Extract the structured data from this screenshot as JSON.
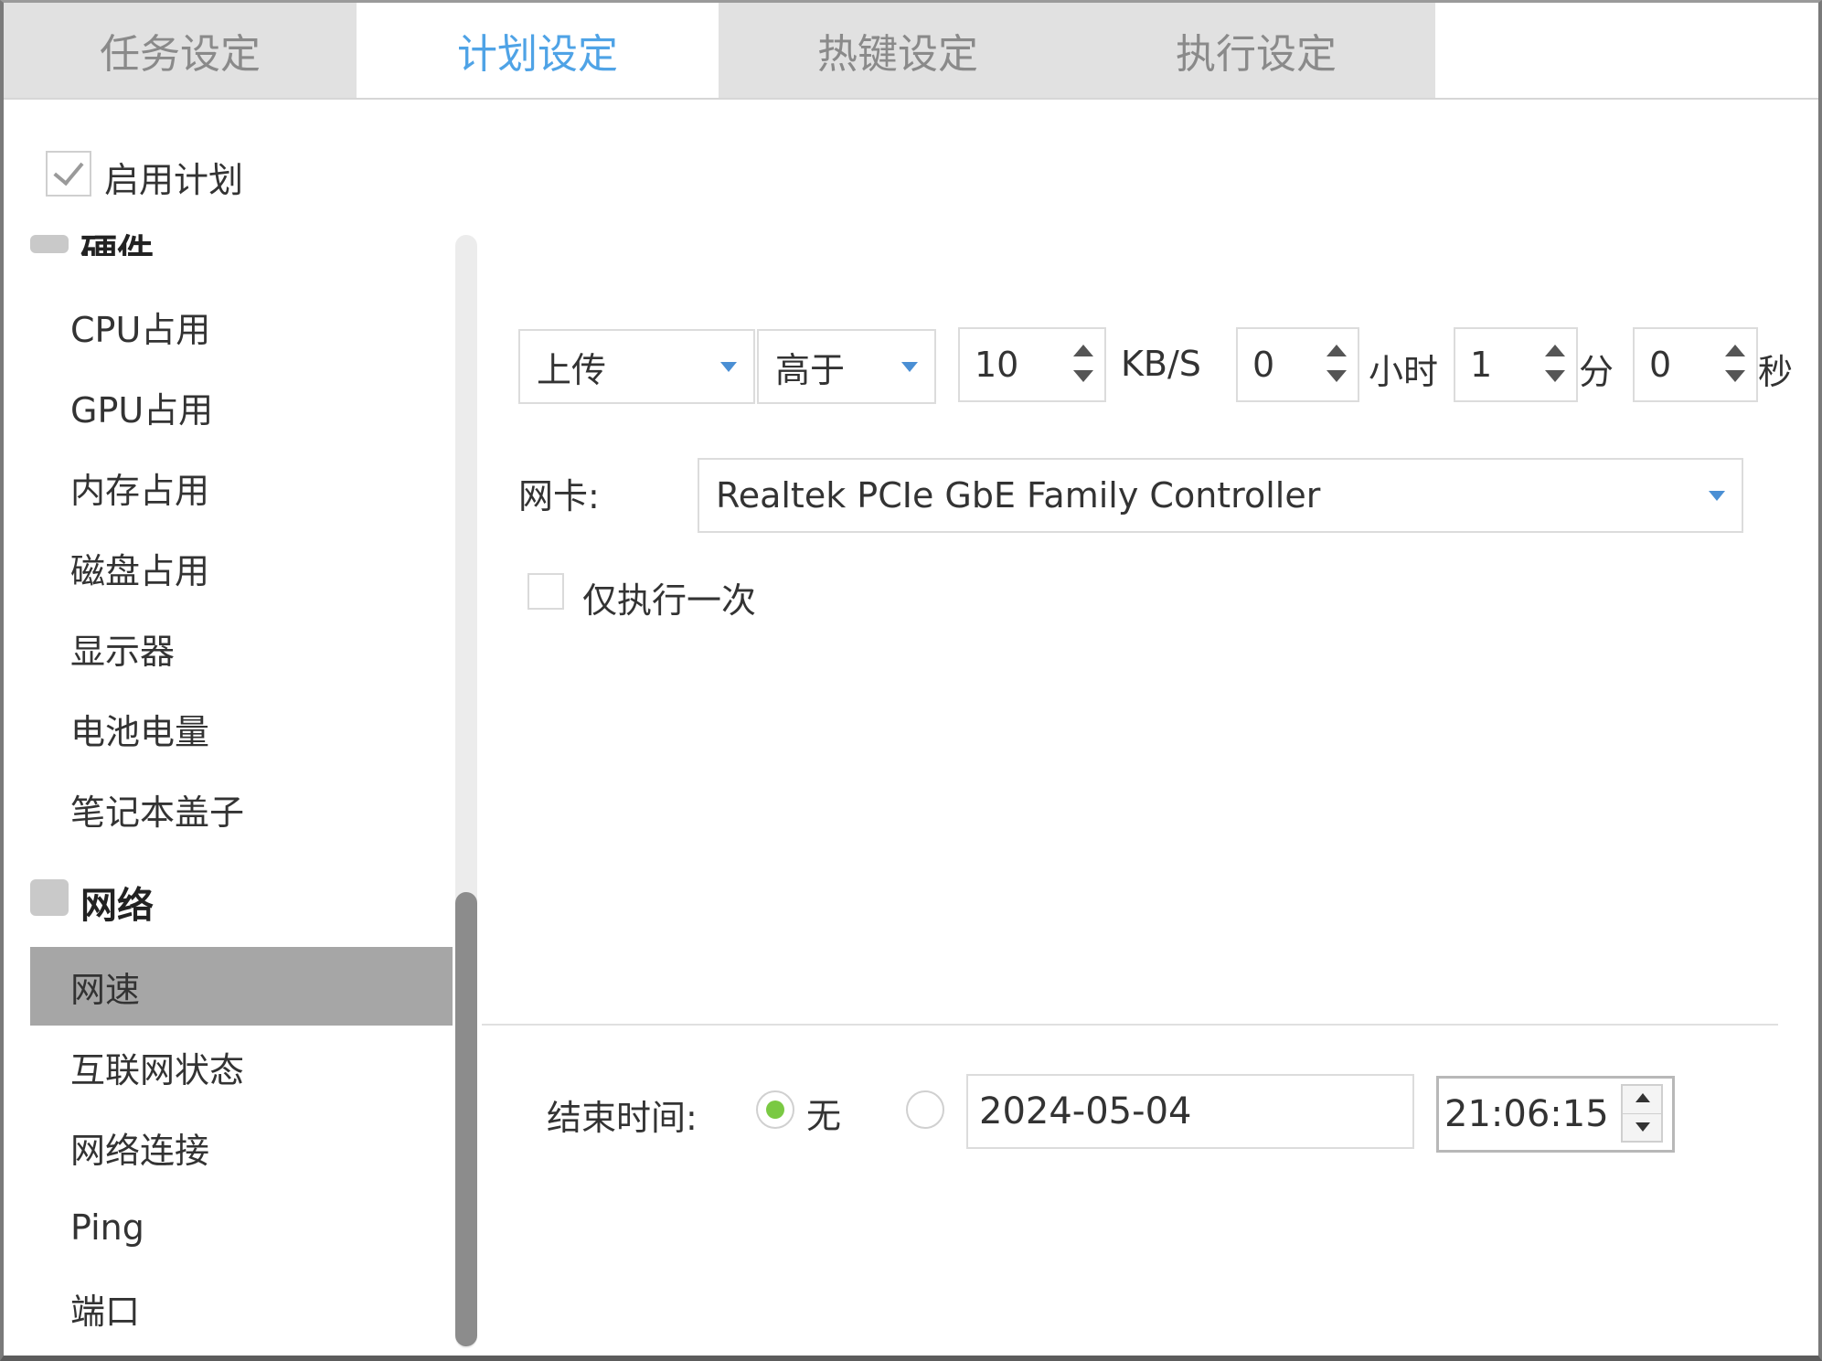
{
  "tabs": [
    {
      "label": "任务设定",
      "active": false
    },
    {
      "label": "计划设定",
      "active": true
    },
    {
      "label": "热键设定",
      "active": false
    },
    {
      "label": "执行设定",
      "active": false
    }
  ],
  "enable_plan": {
    "label": "启用计划",
    "checked": true
  },
  "sidebar": {
    "groups": [
      {
        "label": "硬件",
        "items": [
          "CPU占用",
          "GPU占用",
          "内存占用",
          "磁盘占用",
          "显示器",
          "电池电量",
          "笔记本盖子"
        ]
      },
      {
        "label": "网络",
        "items": [
          "网速",
          "互联网状态",
          "网络连接",
          "Ping",
          "端口"
        ],
        "selected": "网速"
      }
    ]
  },
  "condition": {
    "direction": "上传",
    "comparison": "高于",
    "threshold": "10",
    "rate_unit": "KB/S",
    "hours": "0",
    "hours_unit": "小时",
    "minutes": "1",
    "minutes_unit": "分",
    "seconds": "0",
    "seconds_unit": "秒"
  },
  "nic": {
    "label": "网卡:",
    "value": "Realtek PCIe GbE Family Controller"
  },
  "run_once": {
    "label": "仅执行一次",
    "checked": false
  },
  "end_time": {
    "label": "结束时间:",
    "option_none": "无",
    "selected": "无",
    "date": "2024-05-04",
    "time": "21:06:15"
  },
  "colors": {
    "active_tab_text": "#4fa3e6",
    "tab_bg": "#e1e1e1",
    "selected_item_bg": "#a6a6a6",
    "radio_dot": "#7ac943",
    "caret": "#4a8fd4"
  }
}
